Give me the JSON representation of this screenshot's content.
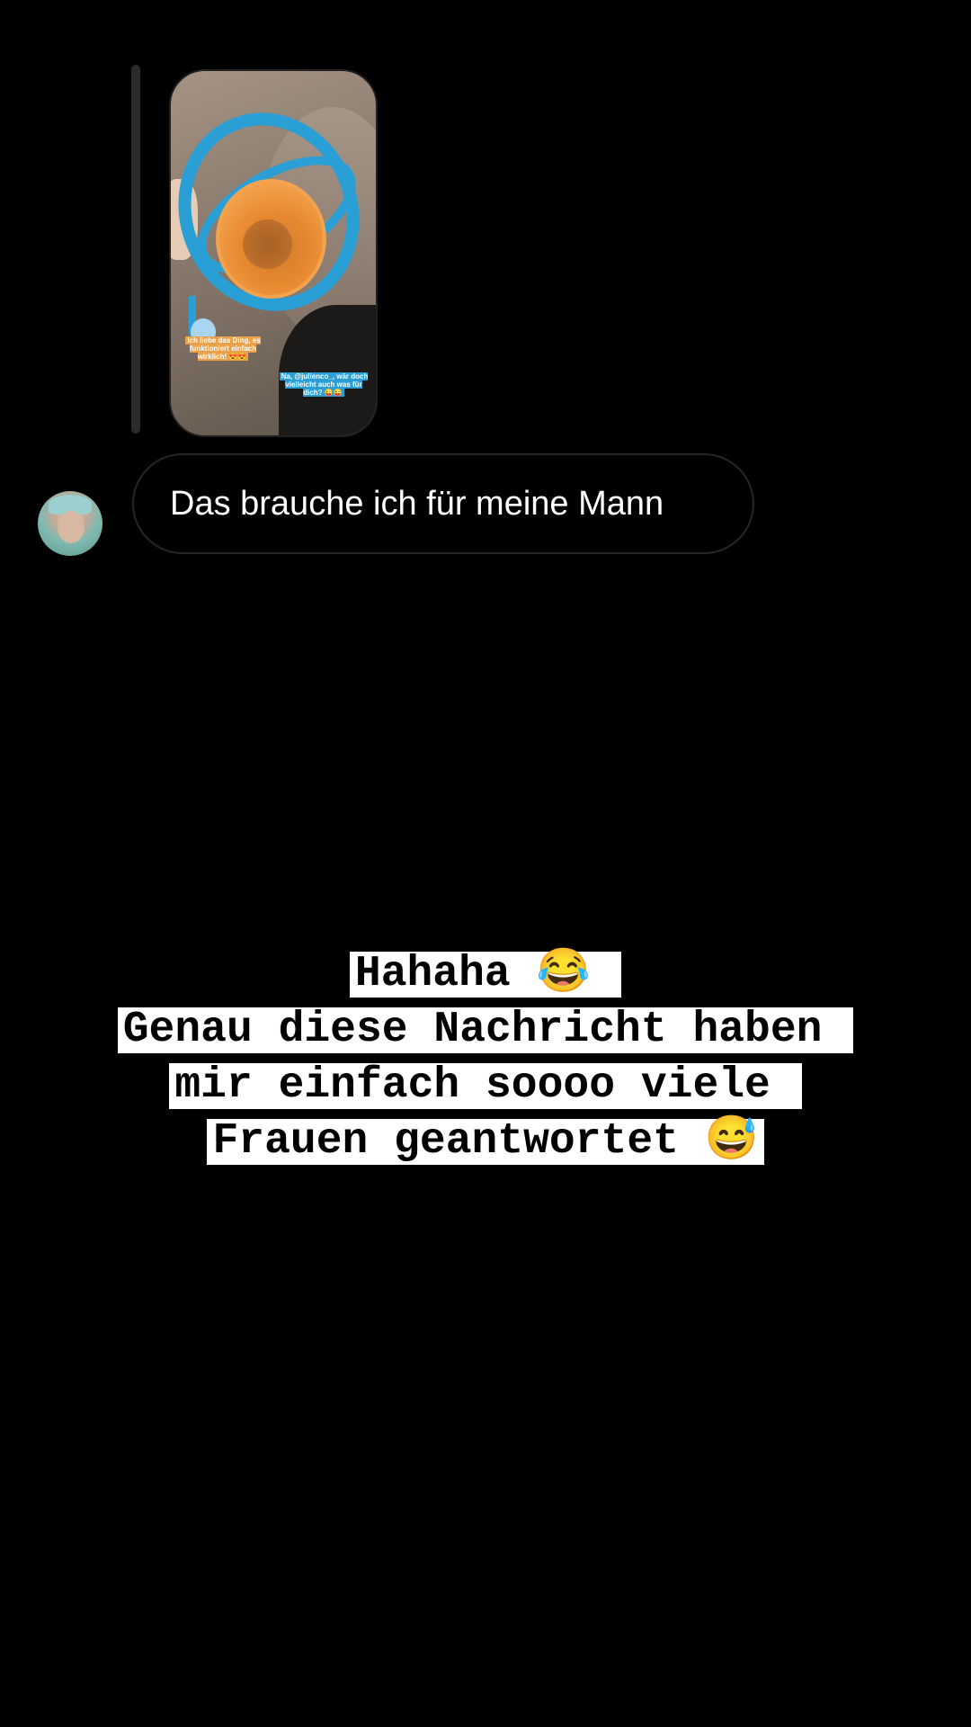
{
  "story_reply": {
    "caption_left": "Ich liebe das Ding, es funktioniert einfach wirklich! 😍😍",
    "caption_right": "Na, @julienco_, wär doch vielleicht auch was für dich? 😜😜"
  },
  "message": {
    "text": "Das brauche ich für meine Mann"
  },
  "overlay": {
    "lines": [
      "Hahaha 😂 ",
      "Genau diese Nachricht haben ",
      "mir einfach soooo viele ",
      "Frauen geantwortet 😅"
    ]
  }
}
